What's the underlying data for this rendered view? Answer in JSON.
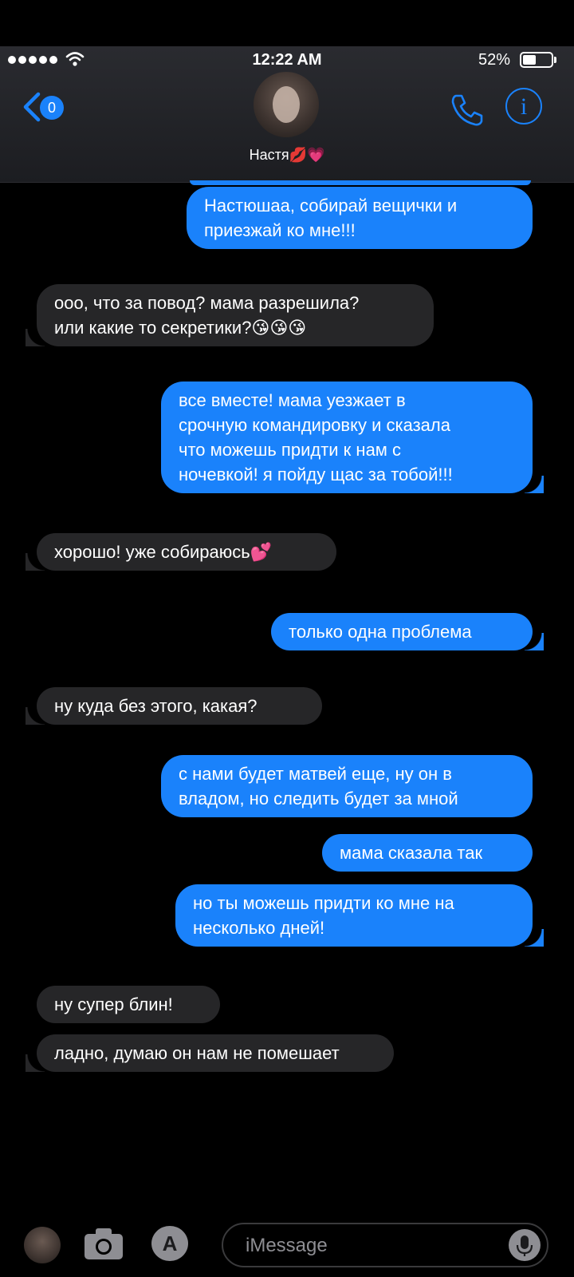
{
  "status": {
    "time": "12:22 AM",
    "battery": "52%",
    "battery_level": 0.52
  },
  "header": {
    "contact_name": "Настя💋💗",
    "back_badge": "0"
  },
  "messages": [
    {
      "dir": "sent",
      "text": "Настюшаа, собирай вещички и\nприезжай ко мне!!!"
    },
    {
      "dir": "recv",
      "text": "ооо, что за повод? мама разрешила?\nили какие то секретики?😘😘😘"
    },
    {
      "dir": "sent",
      "text": "все вместе! мама уезжает в\nсрочную командировку и сказала\nчто можешь придти к нам с\nночевкой! я пойду щас за тобой!!!"
    },
    {
      "dir": "recv",
      "text": "хорошо! уже собираюсь💕"
    },
    {
      "dir": "sent",
      "text": "только одна проблема"
    },
    {
      "dir": "recv",
      "text": "ну куда без этого, какая?"
    },
    {
      "dir": "sent",
      "text": "с нами будет матвей еще, ну он в\nвладом, но следить будет за мной"
    },
    {
      "dir": "sent",
      "text": "мама сказала так"
    },
    {
      "dir": "sent",
      "text": "но ты можешь придти ко мне на\nнесколько дней!"
    },
    {
      "dir": "recv",
      "text": "ну супер блин!"
    },
    {
      "dir": "recv",
      "text": "ладно, думаю он нам не помешает"
    }
  ],
  "composer": {
    "placeholder": "iMessage"
  },
  "icons": {
    "back": "chevron-left-icon",
    "phone": "phone-icon",
    "info": "info-icon",
    "camera": "camera-icon",
    "apps": "app-store-icon",
    "mic": "microphone-icon"
  },
  "colors": {
    "sent_bubble": "#1a82fb",
    "received_bubble": "#262628",
    "accent": "#1a82fb",
    "background": "#000000"
  }
}
